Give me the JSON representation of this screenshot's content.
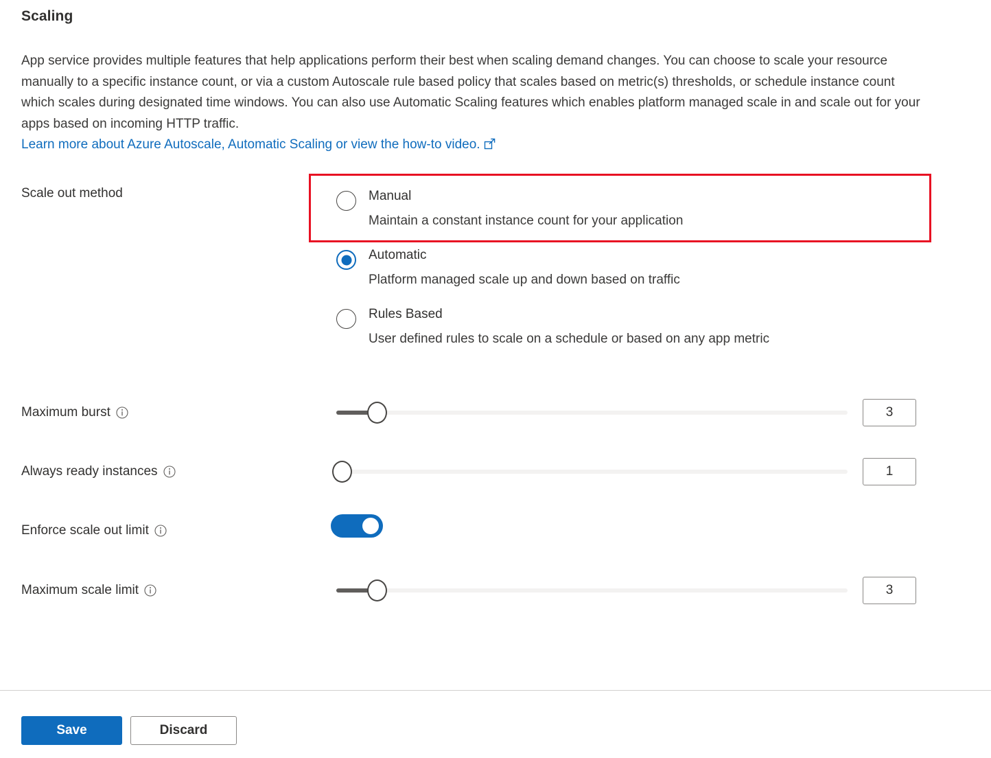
{
  "page": {
    "title": "Scaling",
    "description_text": "App service provides multiple features that help applications perform their best when scaling demand changes. You can choose to scale your resource manually to a specific instance count, or via a custom Autoscale rule based policy that scales based on metric(s) thresholds, or schedule instance count which scales during designated time windows. You can also use Automatic Scaling features which enables platform managed scale in and scale out for your apps based on incoming HTTP traffic.",
    "learn_more_link": "Learn more about Azure Autoscale, Automatic Scaling or view the how-to video.",
    "external_link_icon": "external-link-icon"
  },
  "scale_out_method": {
    "label": "Scale out method",
    "selected": "Automatic",
    "options": [
      {
        "value": "Manual",
        "title": "Manual",
        "description": "Maintain a constant instance count for your application",
        "checked": false,
        "highlighted": true
      },
      {
        "value": "Automatic",
        "title": "Automatic",
        "description": "Platform managed scale up and down based on traffic",
        "checked": true,
        "highlighted": false
      },
      {
        "value": "RulesBased",
        "title": "Rules Based",
        "description": "User defined rules to scale on a schedule or based on any app metric",
        "checked": false,
        "highlighted": false
      }
    ]
  },
  "settings": {
    "maximum_burst": {
      "label": "Maximum burst",
      "info_icon": "info-icon",
      "value": "3",
      "slider_percent": 8
    },
    "always_ready_instances": {
      "label": "Always ready instances",
      "info_icon": "info-icon",
      "value": "1",
      "slider_percent": 0
    },
    "enforce_scale_out_limit": {
      "label": "Enforce scale out limit",
      "info_icon": "info-icon",
      "toggle_on": true
    },
    "maximum_scale_limit": {
      "label": "Maximum scale limit",
      "info_icon": "info-icon",
      "value": "3",
      "slider_percent": 8
    }
  },
  "footer": {
    "save_label": "Save",
    "discard_label": "Discard"
  },
  "colors": {
    "accent": "#0f6cbd",
    "highlight_border": "#e81123",
    "text": "#323130",
    "track": "#f3f2f1",
    "fill": "#605e5c"
  }
}
